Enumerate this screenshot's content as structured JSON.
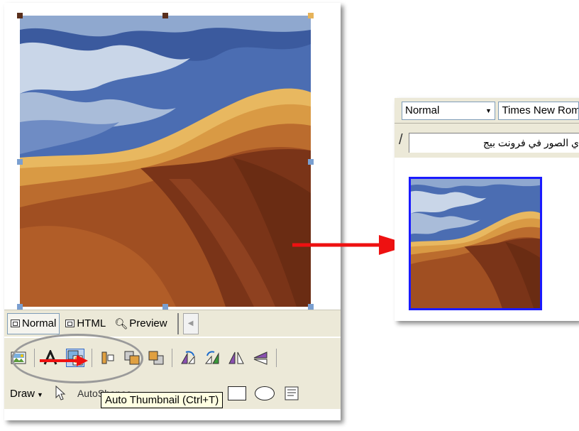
{
  "editor": {
    "view_tabs": [
      {
        "label": "Normal",
        "icon": "page-icon",
        "active": true
      },
      {
        "label": "HTML",
        "icon": "html-icon",
        "active": false
      },
      {
        "label": "Preview",
        "icon": "magnifier-icon",
        "active": false
      }
    ],
    "draw_label": "Draw",
    "autoshapes_label": "AutoShapes",
    "tooltip": "Auto Thumbnail (Ctrl+T)"
  },
  "preview": {
    "style_value": "Normal",
    "font_value": "Times New Roman",
    "tab_title": "ي الصور في فرونت بيج"
  },
  "colors": {
    "toolbar_bg": "#ece9d8",
    "arrow_red": "#ee1111",
    "thumb_border": "#1a1aff",
    "sky": "#5a7dc0",
    "dune_light": "#e8b860",
    "dune_dark": "#7a3418"
  }
}
